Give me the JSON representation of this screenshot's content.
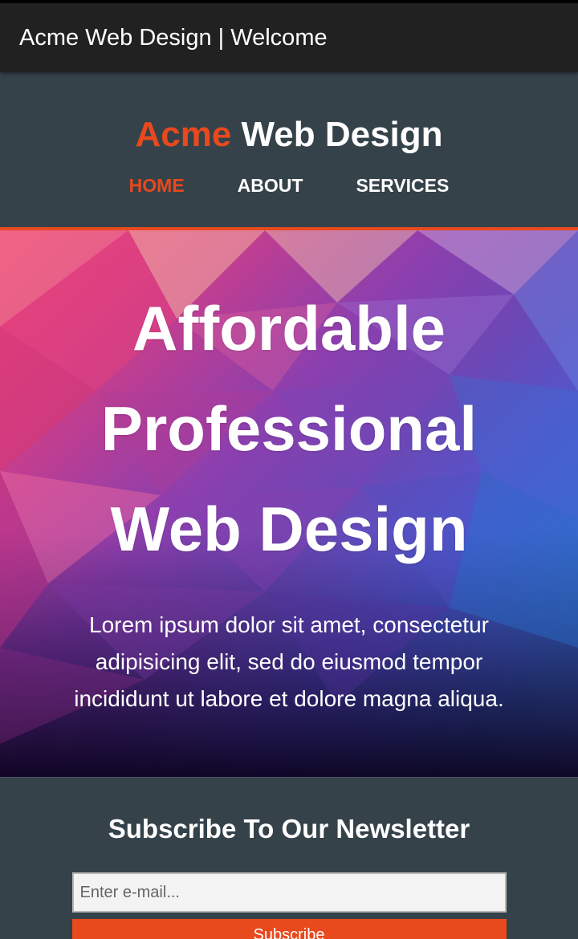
{
  "window": {
    "title": "Acme Web Design | Welcome"
  },
  "header": {
    "brand_highlight": "Acme",
    "brand_rest": "Web Design",
    "nav": [
      {
        "label": "HOME",
        "current": true
      },
      {
        "label": "ABOUT",
        "current": false
      },
      {
        "label": "SERVICES",
        "current": false
      }
    ]
  },
  "showcase": {
    "heading": "Affordable Professional Web Design",
    "body": "Lorem ipsum dolor sit amet, consectetur adipisicing elit, sed do eiusmod tempor incididunt ut labore et dolore magna aliqua."
  },
  "newsletter": {
    "heading": "Subscribe To Our Newsletter",
    "email_placeholder": "Enter e-mail...",
    "submit_label": "Subscribe"
  },
  "colors": {
    "accent": "#e8491d",
    "header_bg": "#35424a",
    "titlebar_bg": "#212121"
  }
}
